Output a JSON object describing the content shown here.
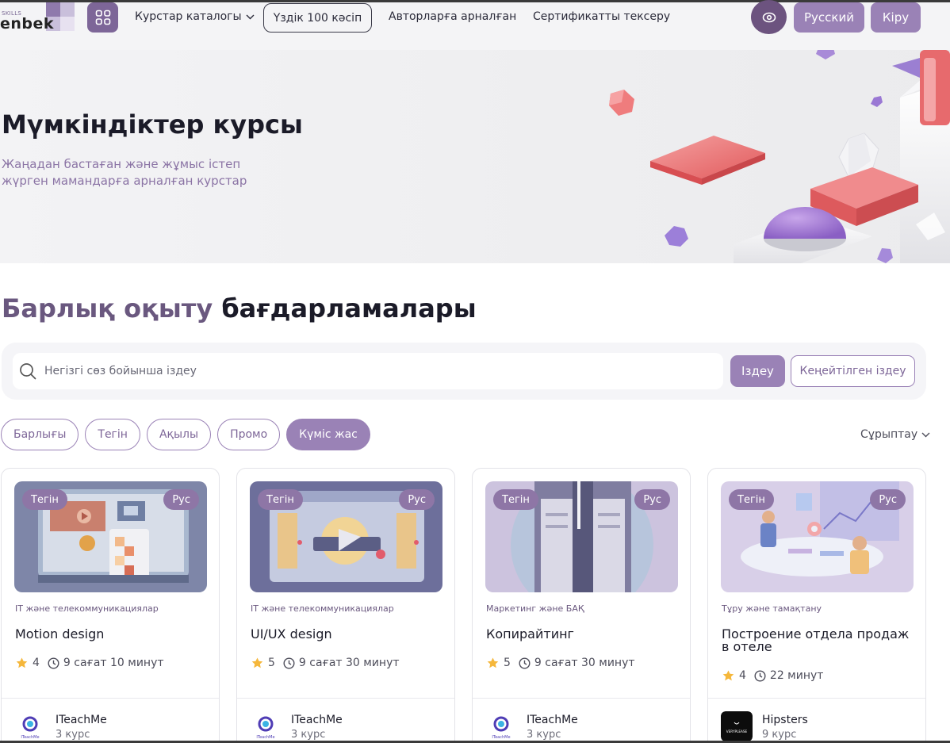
{
  "header": {
    "logo_small": "SKILLS",
    "logo_text": "enbek",
    "catalog_label": "Курстар каталогы",
    "top100_label": "Үздік 100 кәсіп",
    "authors_label": "Авторларға арналған",
    "certificate_label": "Сертификатты тексеру",
    "language_label": "Русский",
    "login_label": "Кіру"
  },
  "hero": {
    "title": "Мүмкіндіктер курсы",
    "subtitle": "Жаңадан бастаған және жұмыс істеп жүрген мамандарға арналған курстар"
  },
  "section": {
    "title_part1": "Барлық оқыту",
    "title_part2": "бағдарламалары"
  },
  "search": {
    "placeholder": "Негізгі сөз бойынша іздеу",
    "button_label": "Іздеу",
    "advanced_label": "Кеңейтілген іздеу"
  },
  "filters": [
    "Барлығы",
    "Тегін",
    "Ақылы",
    "Промо",
    "Күміс жас"
  ],
  "active_filter": "Күміс жас",
  "sort_label": "Сұрыптау",
  "colors": {
    "accent": "#9a82b6",
    "accent_dark": "#6c537f",
    "title_purple": "#6a587f"
  },
  "cards": [
    {
      "badge_left": "Тегін",
      "badge_right": "Рус",
      "category": "IT және телекоммуникациялар",
      "title": "Motion design",
      "rating": "4",
      "duration": "9 сағат 10 минут",
      "author": "ITeachMe",
      "author_courses": "3 курс",
      "author_logo_text": "ITeachMe"
    },
    {
      "badge_left": "Тегін",
      "badge_right": "Рус",
      "category": "IT және телекоммуникациялар",
      "title": "UI/UX design",
      "rating": "5",
      "duration": "9 сағат 30 минут",
      "author": "ITeachMe",
      "author_courses": "3 курс",
      "author_logo_text": "ITeachMe"
    },
    {
      "badge_left": "Тегін",
      "badge_right": "Рус",
      "category": "Маркетинг және БАҚ",
      "title": "Копирайтинг",
      "rating": "5",
      "duration": "9 сағат 30 минут",
      "author": "ITeachMe",
      "author_courses": "3 курс",
      "author_logo_text": "ITeachMe"
    },
    {
      "badge_left": "Тегін",
      "badge_right": "Рус",
      "category": "Тұру және тамақтану",
      "title": "Построение отдела продаж в отеле",
      "rating": "4",
      "duration": "22 минут",
      "author": "Hipsters",
      "author_courses": "9 курс",
      "author_logo_text": "VERYPLEASE"
    }
  ]
}
